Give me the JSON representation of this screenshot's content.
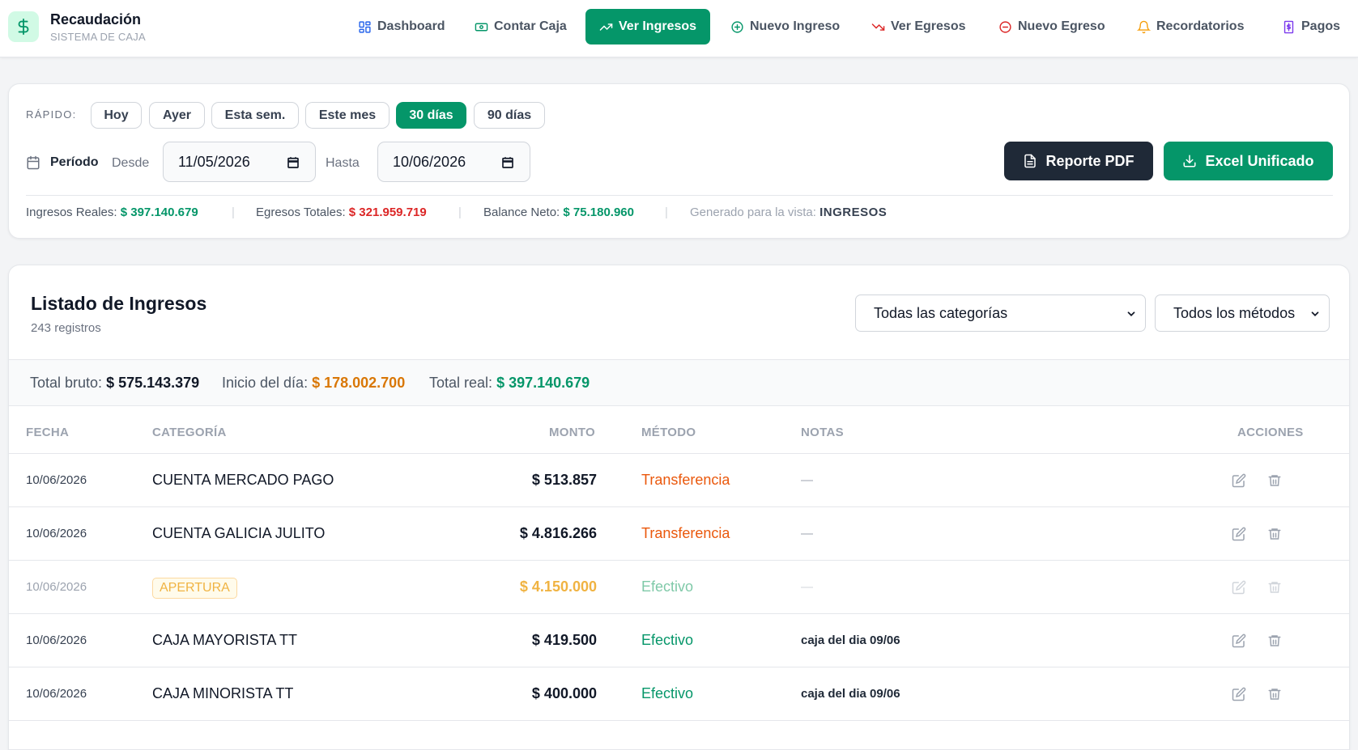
{
  "brand": {
    "title": "Recaudación",
    "subtitle": "SISTEMA DE CAJA",
    "logo_icon": "dollar-icon"
  },
  "nav": {
    "dashboard": "Dashboard",
    "contar_caja": "Contar Caja",
    "ver_ingresos": "Ver Ingresos",
    "nuevo_ingreso": "Nuevo Ingreso",
    "ver_egresos": "Ver Egresos",
    "nuevo_egreso": "Nuevo Egreso",
    "recordatorios": "Recordatorios",
    "pagos": "Pagos",
    "active": "ver_ingresos"
  },
  "filters": {
    "quick_label": "RÁPIDO:",
    "quick": {
      "hoy": "Hoy",
      "ayer": "Ayer",
      "esta_sem": "Esta sem.",
      "este_mes": "Este mes",
      "d30": "30 días",
      "d90": "90 días"
    },
    "active_quick": "30 días",
    "period_label": "Período",
    "desde_label": "Desde",
    "desde_value": "11/05/2026",
    "hasta_label": "Hasta",
    "hasta_value": "10/06/2026",
    "btn_pdf": "Reporte PDF",
    "btn_excel": "Excel Unificado"
  },
  "summary": {
    "ingresos_label": "Ingresos Reales:",
    "ingresos_value": "$ 397.140.679",
    "egresos_label": "Egresos Totales:",
    "egresos_value": "$ 321.959.719",
    "balance_label": "Balance Neto:",
    "balance_value": "$ 75.180.960",
    "generado_label": "Generado para la vista:",
    "generado_value": "INGRESOS",
    "separator": "|"
  },
  "list": {
    "title": "Listado de Ingresos",
    "count": "243 registros",
    "select_categorias": "Todas las categorías",
    "select_metodos": "Todos los métodos",
    "totals": {
      "bruto_label": "Total bruto:",
      "bruto_value": "$ 575.143.379",
      "inicio_label": "Inicio del día:",
      "inicio_value": "$ 178.002.700",
      "real_label": "Total real:",
      "real_value": "$ 397.140.679"
    },
    "columns": {
      "fecha": "FECHA",
      "categoria": "CATEGORÍA",
      "monto": "MONTO",
      "metodo": "MÉTODO",
      "notas": "NOTAS",
      "acciones": "ACCIONES"
    },
    "rows": [
      {
        "fecha": "10/06/2026",
        "categoria": "CUENTA MERCADO PAGO",
        "monto": "$ 513.857",
        "metodo": "Transferencia",
        "notas": "—"
      },
      {
        "fecha": "10/06/2026",
        "categoria": "CUENTA GALICIA JULITO",
        "monto": "$ 4.816.266",
        "metodo": "Transferencia",
        "notas": "—"
      },
      {
        "fecha": "10/06/2026",
        "categoria": "APERTURA",
        "monto": "$ 4.150.000",
        "metodo": "Efectivo",
        "notas": "—"
      },
      {
        "fecha": "10/06/2026",
        "categoria": "CAJA MAYORISTA TT",
        "monto": "$ 419.500",
        "metodo": "Efectivo",
        "notas": "caja del dia 09/06"
      },
      {
        "fecha": "10/06/2026",
        "categoria": "CAJA MINORISTA TT",
        "monto": "$ 400.000",
        "metodo": "Efectivo",
        "notas": "caja del dia 09/06"
      }
    ]
  },
  "colors": {
    "accent": "#059669",
    "expense": "#dc2626",
    "amber": "#d97706",
    "transfer": "#ea580c",
    "dark_button": "#1f2937"
  }
}
